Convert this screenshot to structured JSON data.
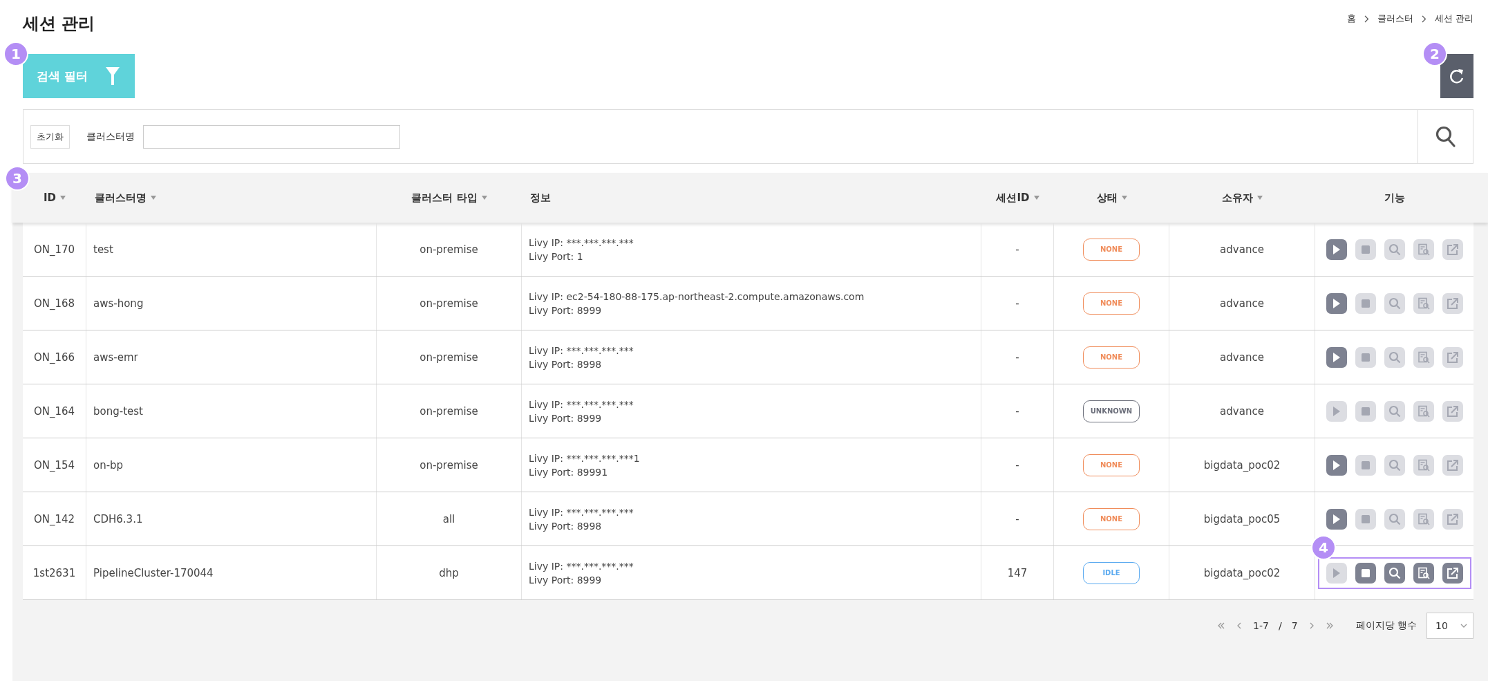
{
  "title": "세션 관리",
  "breadcrumb": [
    "홈",
    "클러스터",
    "세션 관리"
  ],
  "filter_button": {
    "label": "검색 필터",
    "marker": "1"
  },
  "refresh_button": {
    "marker": "2"
  },
  "search": {
    "reset_label": "초기화",
    "field_label": "클러스터명"
  },
  "table": {
    "marker": "3",
    "columns": [
      {
        "label": "ID",
        "sortable": true
      },
      {
        "label": "클러스터명",
        "sortable": true
      },
      {
        "label": "클러스터 타입",
        "sortable": true
      },
      {
        "label": "정보",
        "sortable": false
      },
      {
        "label": "세션ID",
        "sortable": true
      },
      {
        "label": "상태",
        "sortable": true
      },
      {
        "label": "소유자",
        "sortable": true
      },
      {
        "label": "기능",
        "sortable": false
      }
    ],
    "rows": [
      {
        "id": "ON_170",
        "name": "test",
        "type": "on-premise",
        "info": [
          "Livy IP: ***.***.***.***",
          "Livy Port: 1"
        ],
        "session_id": "-",
        "status": {
          "label": "NONE",
          "color": "#f08c5a"
        },
        "owner": "advance",
        "highlighted": false,
        "actions": [
          {
            "kind": "play",
            "enabled": true
          },
          {
            "kind": "stop",
            "enabled": false
          },
          {
            "kind": "search",
            "enabled": false
          },
          {
            "kind": "log",
            "enabled": false
          },
          {
            "kind": "open",
            "enabled": false
          }
        ]
      },
      {
        "id": "ON_168",
        "name": "aws-hong",
        "type": "on-premise",
        "info": [
          "Livy IP: ec2-54-180-88-175.ap-northeast-2.compute.amazonaws.com",
          "Livy Port: 8999"
        ],
        "session_id": "-",
        "status": {
          "label": "NONE",
          "color": "#f08c5a"
        },
        "owner": "advance",
        "highlighted": false,
        "actions": [
          {
            "kind": "play",
            "enabled": true
          },
          {
            "kind": "stop",
            "enabled": false
          },
          {
            "kind": "search",
            "enabled": false
          },
          {
            "kind": "log",
            "enabled": false
          },
          {
            "kind": "open",
            "enabled": false
          }
        ]
      },
      {
        "id": "ON_166",
        "name": "aws-emr",
        "type": "on-premise",
        "info": [
          "Livy IP: ***.***.***.***",
          "Livy Port: 8998"
        ],
        "session_id": "-",
        "status": {
          "label": "NONE",
          "color": "#f08c5a"
        },
        "owner": "advance",
        "highlighted": false,
        "actions": [
          {
            "kind": "play",
            "enabled": true
          },
          {
            "kind": "stop",
            "enabled": false
          },
          {
            "kind": "search",
            "enabled": false
          },
          {
            "kind": "log",
            "enabled": false
          },
          {
            "kind": "open",
            "enabled": false
          }
        ]
      },
      {
        "id": "ON_164",
        "name": "bong-test",
        "type": "on-premise",
        "info": [
          "Livy IP: ***.***.***.***",
          "Livy Port: 8999"
        ],
        "session_id": "-",
        "status": {
          "label": "UNKNOWN",
          "color": "#6b6e7a"
        },
        "owner": "advance",
        "highlighted": false,
        "actions": [
          {
            "kind": "play",
            "enabled": false
          },
          {
            "kind": "stop",
            "enabled": false
          },
          {
            "kind": "search",
            "enabled": false
          },
          {
            "kind": "log",
            "enabled": false
          },
          {
            "kind": "open",
            "enabled": false
          }
        ]
      },
      {
        "id": "ON_154",
        "name": "on-bp",
        "type": "on-premise",
        "info": [
          "Livy IP: ***.***.***.***1",
          "Livy Port: 89991"
        ],
        "session_id": "-",
        "status": {
          "label": "NONE",
          "color": "#f08c5a"
        },
        "owner": "bigdata_poc02",
        "highlighted": false,
        "actions": [
          {
            "kind": "play",
            "enabled": true
          },
          {
            "kind": "stop",
            "enabled": false
          },
          {
            "kind": "search",
            "enabled": false
          },
          {
            "kind": "log",
            "enabled": false
          },
          {
            "kind": "open",
            "enabled": false
          }
        ]
      },
      {
        "id": "ON_142",
        "name": "CDH6.3.1",
        "type": "all",
        "info": [
          "Livy IP: ***.***.***.***",
          "Livy Port: 8998"
        ],
        "session_id": "-",
        "status": {
          "label": "NONE",
          "color": "#f08c5a"
        },
        "owner": "bigdata_poc05",
        "highlighted": false,
        "actions": [
          {
            "kind": "play",
            "enabled": true
          },
          {
            "kind": "stop",
            "enabled": false
          },
          {
            "kind": "search",
            "enabled": false
          },
          {
            "kind": "log",
            "enabled": false
          },
          {
            "kind": "open",
            "enabled": false
          }
        ]
      },
      {
        "id": "1st2631",
        "name": "PipelineCluster-170044",
        "type": "dhp",
        "info": [
          "Livy IP: ***.***.***.***",
          "Livy Port: 8999"
        ],
        "session_id": "147",
        "status": {
          "label": "IDLE",
          "color": "#5aaaf0"
        },
        "owner": "bigdata_poc02",
        "highlighted": true,
        "marker": "4",
        "actions": [
          {
            "kind": "play",
            "enabled": false
          },
          {
            "kind": "stop",
            "enabled": true
          },
          {
            "kind": "search",
            "enabled": true
          },
          {
            "kind": "log",
            "enabled": true
          },
          {
            "kind": "open",
            "enabled": true
          }
        ]
      }
    ]
  },
  "pagination": {
    "range": "1-7",
    "separator": "/",
    "total": "7",
    "rows_label": "페이지당 행수",
    "rows_per_page": "10"
  }
}
